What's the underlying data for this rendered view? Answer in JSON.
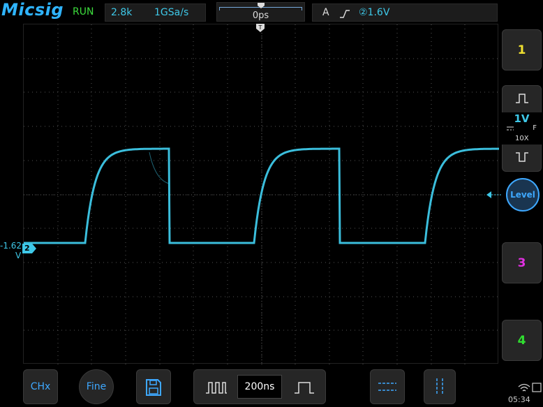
{
  "brand": "Micsig",
  "run_state": "RUN",
  "acquisition": {
    "memory_depth": "2.8k",
    "sample_rate": "1GSa/s"
  },
  "horizontal": {
    "trigger_position": "0ps",
    "timebase": "200ns"
  },
  "trigger": {
    "mode": "A",
    "edge_icon": "rising-edge-icon",
    "source_level": "②1.6V"
  },
  "channel_marker": {
    "label": "2",
    "offset_value": "-1.62",
    "offset_unit": "V"
  },
  "right_panel": {
    "ch1_label": "1",
    "ch2": {
      "scale": "1V",
      "coupling_icon": "dc-coupling-icon",
      "bandwidth": "F",
      "probe": "10X"
    },
    "level_label": "Level",
    "ch3_label": "3",
    "ch4_label": "4"
  },
  "bottom_bar": {
    "chx_label": "CHx",
    "fine_label": "Fine",
    "save_icon": "save-icon",
    "zoom_out_icon": "wide-pulse-icon",
    "zoom_in_icon": "narrow-pulse-icon",
    "cursor_h_icon": "horizontal-cursor-icon",
    "cursor_v_icon": "vertical-cursor-icon"
  },
  "status_bar": {
    "time": "05:34",
    "wifi_icon": "wifi-icon",
    "battery_icon": "battery-icon"
  },
  "colors": {
    "channel2": "#3ec8e8",
    "channel3": "#e030e0",
    "channel4": "#30e030",
    "channel1": "#f0e030",
    "accent": "#3ea8ff",
    "run": "#3ddc3d"
  }
}
